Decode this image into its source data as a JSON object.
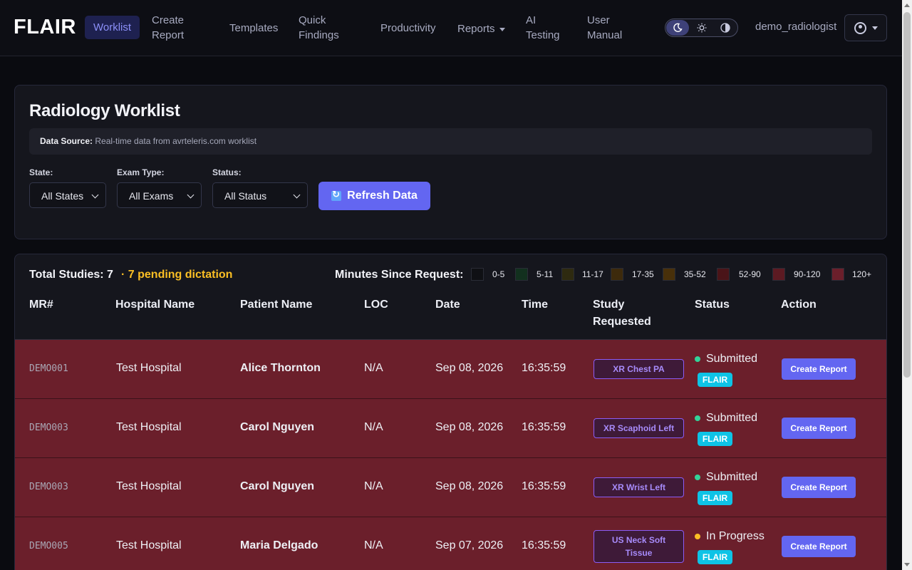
{
  "nav": {
    "brand": "FLAIR",
    "items": [
      {
        "label": "Worklist"
      },
      {
        "label": "Create Report"
      },
      {
        "label": "Templates"
      },
      {
        "label": "Quick Findings"
      },
      {
        "label": "Productivity"
      },
      {
        "label": "Reports"
      },
      {
        "label": "AI Testing"
      },
      {
        "label": "User Manual"
      }
    ],
    "theme_modes": [
      "dark-moon-icon",
      "light-sun-icon",
      "contrast-icon"
    ],
    "username": "demo_radiologist"
  },
  "filters": {
    "title": "Radiology Worklist",
    "data_source_label": "Data Source:",
    "data_source_value": "Real-time data from avrteleris.com worklist",
    "state_label": "State:",
    "state_value": "All States",
    "exam_label": "Exam Type:",
    "exam_value": "All Exams",
    "status_label": "Status:",
    "status_value": "All Status",
    "refresh_label": "Refresh Data"
  },
  "worklist": {
    "total": "Total Studies: 7",
    "pending": "· 7 pending dictation",
    "legend_title": "Minutes Since Request:",
    "legend": [
      {
        "label": "0-5",
        "color": "#0f1014"
      },
      {
        "label": "5-11",
        "color": "#12301e"
      },
      {
        "label": "11-17",
        "color": "#2e2a10"
      },
      {
        "label": "17-35",
        "color": "#3d2a0c"
      },
      {
        "label": "35-52",
        "color": "#48300a"
      },
      {
        "label": "52-90",
        "color": "#4a1418"
      },
      {
        "label": "90-120",
        "color": "#5c1a22"
      },
      {
        "label": "120+",
        "color": "#6b1f2b"
      }
    ],
    "columns": [
      "MR#",
      "Hospital Name",
      "Patient Name",
      "LOC",
      "Date",
      "Time",
      "Study Requested",
      "Status",
      "Action"
    ],
    "rows": [
      {
        "mr": "DEMO001",
        "hospital": "Test Hospital",
        "patient": "Alice Thornton",
        "loc": "N/A",
        "date": "Sep 08, 2026",
        "time": "16:35:59",
        "study": "XR Chest PA",
        "status": "Submitted",
        "status_color": "#34d399",
        "tag": "FLAIR",
        "action": "Create Report"
      },
      {
        "mr": "DEMO003",
        "hospital": "Test Hospital",
        "patient": "Carol Nguyen",
        "loc": "N/A",
        "date": "Sep 08, 2026",
        "time": "16:35:59",
        "study": "XR Scaphoid Left",
        "status": "Submitted",
        "status_color": "#34d399",
        "tag": "FLAIR",
        "action": "Create Report"
      },
      {
        "mr": "DEMO003",
        "hospital": "Test Hospital",
        "patient": "Carol Nguyen",
        "loc": "N/A",
        "date": "Sep 08, 2026",
        "time": "16:35:59",
        "study": "XR Wrist Left",
        "status": "Submitted",
        "status_color": "#34d399",
        "tag": "FLAIR",
        "action": "Create Report"
      },
      {
        "mr": "DEMO005",
        "hospital": "Test Hospital",
        "patient": "Maria Delgado",
        "loc": "N/A",
        "date": "Sep 07, 2026",
        "time": "16:35:59",
        "study": "US Neck Soft Tissue",
        "status": "In Progress",
        "status_color": "#fbbf24",
        "tag": "FLAIR",
        "action": "Create Report"
      }
    ]
  }
}
